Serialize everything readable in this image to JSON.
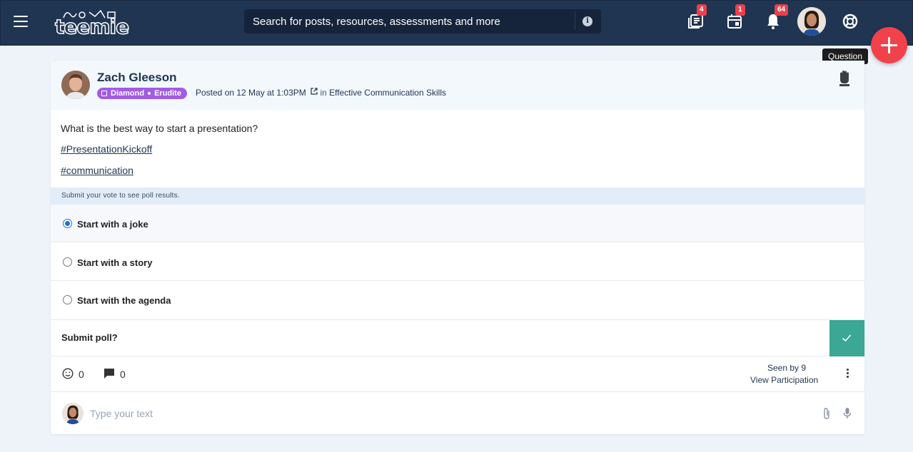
{
  "header": {
    "logo_text": "teemie",
    "search_placeholder": "Search for posts, resources, assessments and more",
    "badges": {
      "resources": "4",
      "calendar": "1",
      "notifications": "64"
    },
    "tooltip": "Question"
  },
  "post": {
    "author": "Zach Gleeson",
    "rank_primary": "Diamond",
    "rank_secondary": "Erudite",
    "posted_prefix": "Posted on 12 May at 1:03PM",
    "in_word": "in",
    "group": "Effective Communication Skills",
    "text": "What is the best way to start a presentation?",
    "hashtags": [
      "#PresentationKickoff",
      "#communication"
    ]
  },
  "poll": {
    "note": "Submit your vote to see poll results.",
    "options": [
      {
        "label": "Start with a joke",
        "selected": true
      },
      {
        "label": "Start with a story",
        "selected": false
      },
      {
        "label": "Start with the agenda",
        "selected": false
      }
    ],
    "submit_label": "Submit poll?"
  },
  "footer": {
    "reactions_count": "0",
    "comments_count": "0",
    "seen_by": "Seen by 9",
    "view_participation": "View Participation",
    "comment_placeholder": "Type your text"
  },
  "colors": {
    "topbar": "#203552",
    "fab": "#f1424b",
    "submit": "#3aa894",
    "rank_badge": "#a15be5",
    "badge": "#e8404c"
  }
}
